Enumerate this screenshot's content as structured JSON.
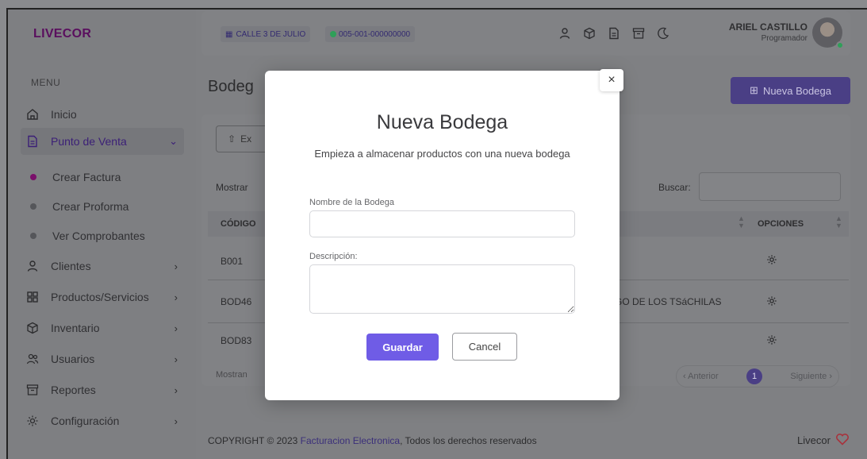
{
  "sidebar": {
    "logo": "LIVECOR",
    "menu_title": "MENU",
    "items": [
      {
        "label": "Inicio",
        "icon": "home-icon"
      },
      {
        "label": "Punto de Venta",
        "icon": "receipt-icon",
        "chevron": "⌄"
      },
      {
        "label": "Clientes",
        "icon": "user-icon",
        "chevron": "›"
      },
      {
        "label": "Productos/Servicios",
        "icon": "grid-icon",
        "chevron": "›"
      },
      {
        "label": "Inventario",
        "icon": "box-icon",
        "chevron": "›"
      },
      {
        "label": "Usuarios",
        "icon": "users-icon",
        "chevron": "›"
      },
      {
        "label": "Reportes",
        "icon": "archive-icon",
        "chevron": "›"
      },
      {
        "label": "Configuración",
        "icon": "gear-icon",
        "chevron": "›"
      }
    ],
    "sub_items": [
      {
        "label": "Crear Factura"
      },
      {
        "label": "Crear Proforma"
      },
      {
        "label": "Ver Comprobantes"
      }
    ]
  },
  "topbar": {
    "branch": "CALLE 3 DE JULIO",
    "code": "005-001-000000000",
    "user_name": "ARIEL CASTILLO",
    "user_role": "Programador"
  },
  "page": {
    "heading": "Bodeg",
    "new_button": "Nueva Bodega",
    "export_button": "Ex",
    "mostrar": "Mostrar",
    "buscar": "Buscar:",
    "col_codigo": "CÓDIGO",
    "col_opciones": "OPCIONES",
    "rows": [
      {
        "code": "B001",
        "desc": ""
      },
      {
        "code": "BOD46",
        "desc": "GO DE LOS TSáCHILAS"
      },
      {
        "code": "BOD83",
        "desc": ""
      }
    ],
    "mostrando": "Mostran",
    "pager_prev": "‹ Anterior",
    "pager_page": "1",
    "pager_next": "Siguiente ›"
  },
  "footer": {
    "prefix": "COPYRIGHT © 2023",
    "link": "Facturacion Electronica",
    "suffix": ", Todos los derechos reservados",
    "brand": "Livecor"
  },
  "modal": {
    "title": "Nueva Bodega",
    "subtitle": "Empieza a almacenar productos con una nueva bodega",
    "name_label": "Nombre de la Bodega",
    "name_value": "",
    "desc_label": "Descripción:",
    "desc_value": "",
    "save": "Guardar",
    "cancel": "Cancel",
    "close": "×"
  }
}
